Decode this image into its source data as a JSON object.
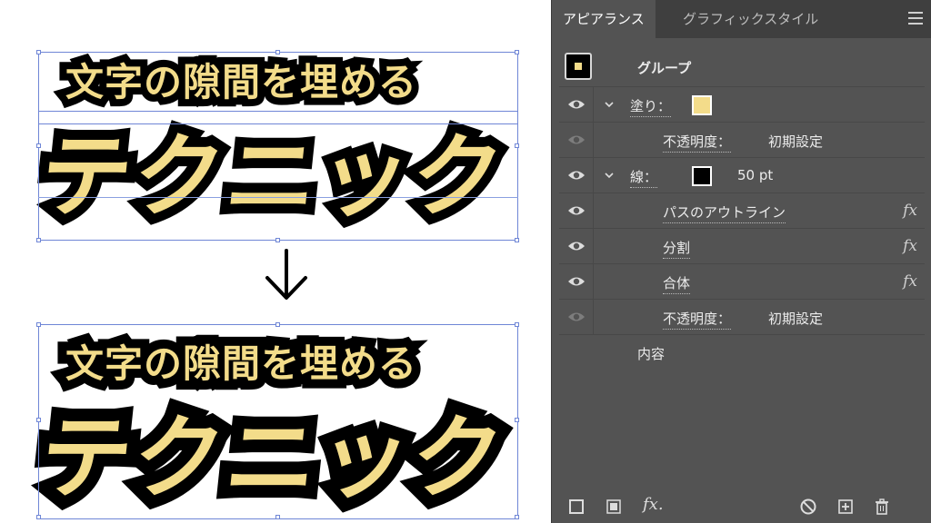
{
  "canvas": {
    "subtitle": "文字の隙間を埋める",
    "headline": "テクニック",
    "arrow_icon": "down-arrow-icon"
  },
  "panel": {
    "tabs": [
      {
        "label": "アピアランス",
        "active": true
      },
      {
        "label": "グラフィックスタイル",
        "active": false
      }
    ],
    "menu_icon": "hamburger-menu-icon",
    "group_label": "グループ",
    "rows": [
      {
        "label": "塗り：",
        "swatch": "#f3dc8a",
        "eye": true
      },
      {
        "label": "不透明度：",
        "value": "初期設定",
        "eye": false
      },
      {
        "label": "線：",
        "swatch": "#000000",
        "value": "50 pt",
        "eye": true
      },
      {
        "label": "パスのアウトライン",
        "fx": "fx",
        "eye": true
      },
      {
        "label": "分割",
        "fx": "fx",
        "eye": true
      },
      {
        "label": "合体",
        "fx": "fx",
        "eye": true
      },
      {
        "label": "不透明度：",
        "value": "初期設定",
        "eye": false
      },
      {
        "label": "内容"
      }
    ],
    "bottom_icons": [
      "new-stroke-icon",
      "new-fill-icon",
      "fx-menu-icon",
      "clear-appearance-icon",
      "duplicate-item-icon",
      "trash-icon"
    ],
    "bottom_fx_label": "fx."
  },
  "colors": {
    "text_fill": "#f3dc8a",
    "text_stroke": "#000000",
    "panel_bg": "#535353",
    "selection": "#6f86d6"
  }
}
